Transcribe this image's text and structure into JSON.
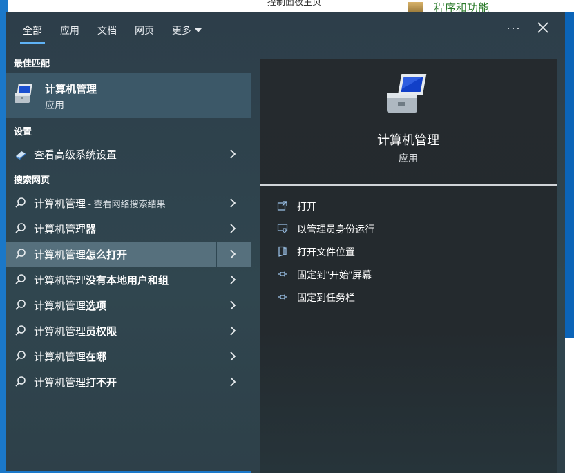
{
  "background": {
    "control_panel_home": "控制面板主页",
    "programs_and_features": "程序和功能"
  },
  "tabs": [
    {
      "label": "全部",
      "active": true
    },
    {
      "label": "应用"
    },
    {
      "label": "文档"
    },
    {
      "label": "网页"
    },
    {
      "label": "更多"
    }
  ],
  "header": {
    "more_options": "···"
  },
  "sections": {
    "best_match": "最佳匹配",
    "settings": "设置",
    "search_web": "搜索网页"
  },
  "best_match": {
    "title": "计算机管理",
    "subtitle": "应用"
  },
  "settings_items": [
    {
      "label": "查看高级系统设置"
    }
  ],
  "web_items": [
    {
      "prefix": "计算机管理",
      "hint": " - 查看网络搜索结果",
      "bold": ""
    },
    {
      "prefix": "计算机管理",
      "bold": "器",
      "hint": ""
    },
    {
      "prefix": "计算机管理",
      "bold": "怎么打开",
      "hint": "",
      "highlighted": true
    },
    {
      "prefix": "计算机管理",
      "bold": "没有本地用户和组",
      "hint": ""
    },
    {
      "prefix": "计算机管理",
      "bold": "选项",
      "hint": ""
    },
    {
      "prefix": "计算机管理",
      "bold": "员权限",
      "hint": ""
    },
    {
      "prefix": "计算机管理",
      "bold": "在哪",
      "hint": ""
    },
    {
      "prefix": "计算机管理",
      "bold": "打不开",
      "hint": ""
    }
  ],
  "detail": {
    "name": "计算机管理",
    "type": "应用",
    "actions": [
      {
        "label": "打开",
        "icon": "open-icon"
      },
      {
        "label": "以管理员身份运行",
        "icon": "shield-run-icon"
      },
      {
        "label": "打开文件位置",
        "icon": "file-location-icon"
      },
      {
        "label": "固定到\"开始\"屏幕",
        "icon": "pin-icon"
      },
      {
        "label": "固定到任务栏",
        "icon": "pin-icon"
      }
    ]
  },
  "colors": {
    "accent": "#5fb2f5",
    "highlight": "#56707d",
    "best_bg": "#3c5868"
  }
}
